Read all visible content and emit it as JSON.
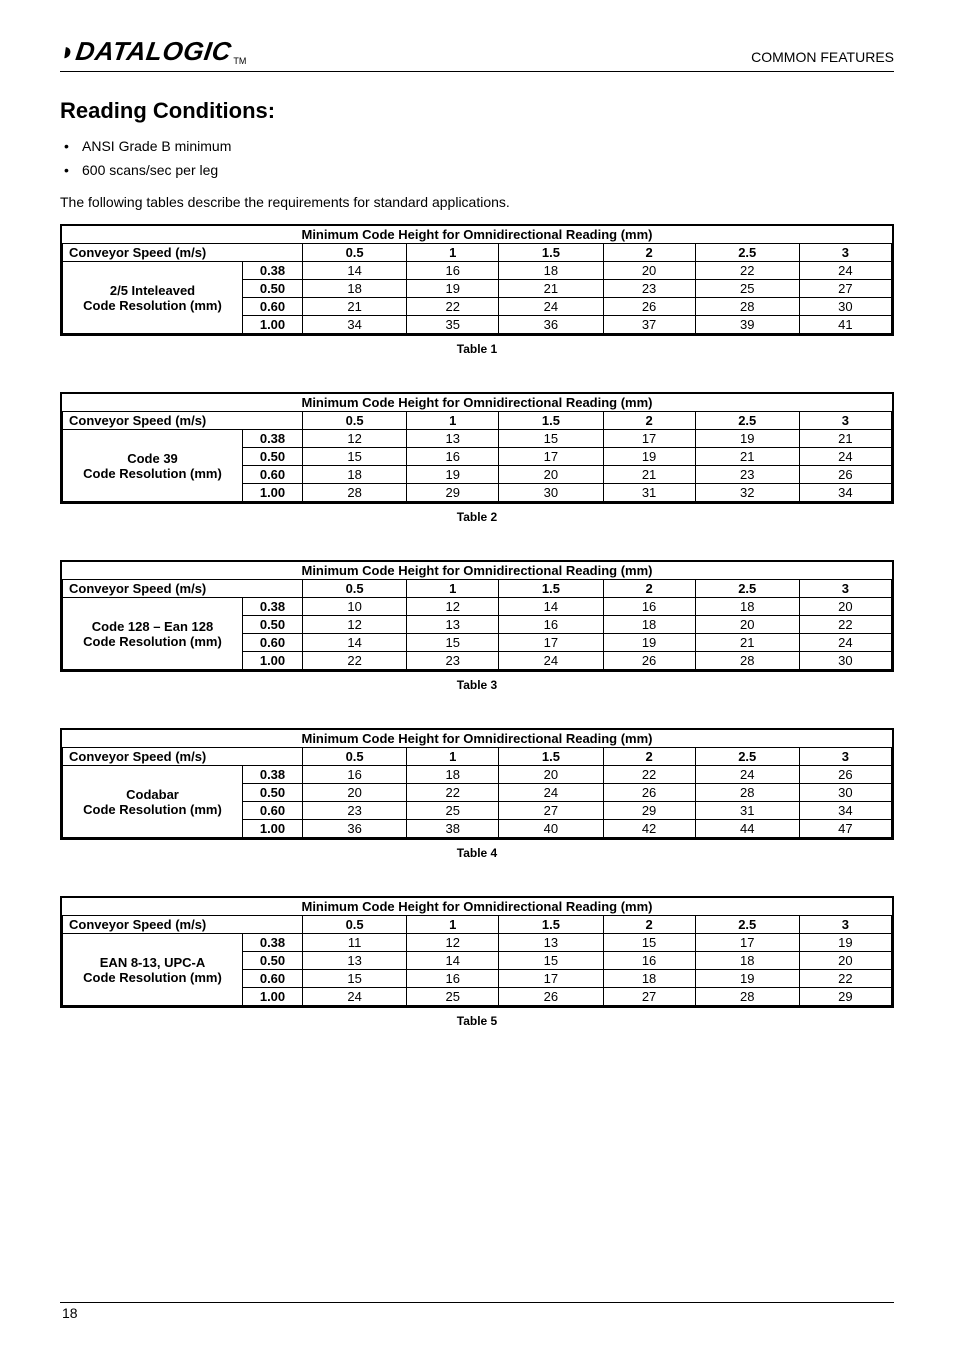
{
  "header": {
    "brand": "DATALOGIC",
    "tm": "TM",
    "section": "COMMON FEATURES"
  },
  "title": "Reading Conditions:",
  "bullets": [
    "ANSI Grade B minimum",
    "600 scans/sec per leg"
  ],
  "intro": "The following tables describe the requirements for standard applications.",
  "common": {
    "tableTitle": "Minimum Code Height for Omnidirectional Reading (mm)",
    "conveyorLabel": "Conveyor Speed (m/s)",
    "speedHeaders": [
      "0.5",
      "1",
      "1.5",
      "2",
      "2.5",
      "3"
    ]
  },
  "tables": [
    {
      "label": [
        "2/5 Inteleaved",
        "Code Resolution (mm)"
      ],
      "caption": "Table 1",
      "rows": [
        {
          "res": "0.38",
          "vals": [
            "14",
            "16",
            "18",
            "20",
            "22",
            "24"
          ]
        },
        {
          "res": "0.50",
          "vals": [
            "18",
            "19",
            "21",
            "23",
            "25",
            "27"
          ]
        },
        {
          "res": "0.60",
          "vals": [
            "21",
            "22",
            "24",
            "26",
            "28",
            "30"
          ]
        },
        {
          "res": "1.00",
          "vals": [
            "34",
            "35",
            "36",
            "37",
            "39",
            "41"
          ]
        }
      ]
    },
    {
      "label": [
        "Code 39",
        "Code Resolution (mm)"
      ],
      "caption": "Table 2",
      "rows": [
        {
          "res": "0.38",
          "vals": [
            "12",
            "13",
            "15",
            "17",
            "19",
            "21"
          ]
        },
        {
          "res": "0.50",
          "vals": [
            "15",
            "16",
            "17",
            "19",
            "21",
            "24"
          ]
        },
        {
          "res": "0.60",
          "vals": [
            "18",
            "19",
            "20",
            "21",
            "23",
            "26"
          ]
        },
        {
          "res": "1.00",
          "vals": [
            "28",
            "29",
            "30",
            "31",
            "32",
            "34"
          ]
        }
      ]
    },
    {
      "label": [
        "Code 128 – Ean 128",
        "Code Resolution (mm)"
      ],
      "caption": "Table 3",
      "rows": [
        {
          "res": "0.38",
          "vals": [
            "10",
            "12",
            "14",
            "16",
            "18",
            "20"
          ]
        },
        {
          "res": "0.50",
          "vals": [
            "12",
            "13",
            "16",
            "18",
            "20",
            "22"
          ]
        },
        {
          "res": "0.60",
          "vals": [
            "14",
            "15",
            "17",
            "19",
            "21",
            "24"
          ]
        },
        {
          "res": "1.00",
          "vals": [
            "22",
            "23",
            "24",
            "26",
            "28",
            "30"
          ]
        }
      ]
    },
    {
      "label": [
        "Codabar",
        "Code Resolution (mm)"
      ],
      "caption": "Table 4",
      "rows": [
        {
          "res": "0.38",
          "vals": [
            "16",
            "18",
            "20",
            "22",
            "24",
            "26"
          ]
        },
        {
          "res": "0.50",
          "vals": [
            "20",
            "22",
            "24",
            "26",
            "28",
            "30"
          ]
        },
        {
          "res": "0.60",
          "vals": [
            "23",
            "25",
            "27",
            "29",
            "31",
            "34"
          ]
        },
        {
          "res": "1.00",
          "vals": [
            "36",
            "38",
            "40",
            "42",
            "44",
            "47"
          ]
        }
      ]
    },
    {
      "label": [
        "EAN 8-13, UPC-A",
        "Code Resolution (mm)"
      ],
      "caption": "Table 5",
      "rows": [
        {
          "res": "0.38",
          "vals": [
            "11",
            "12",
            "13",
            "15",
            "17",
            "19"
          ]
        },
        {
          "res": "0.50",
          "vals": [
            "13",
            "14",
            "15",
            "16",
            "18",
            "20"
          ]
        },
        {
          "res": "0.60",
          "vals": [
            "15",
            "16",
            "17",
            "18",
            "19",
            "22"
          ]
        },
        {
          "res": "1.00",
          "vals": [
            "24",
            "25",
            "26",
            "27",
            "28",
            "29"
          ]
        }
      ]
    }
  ],
  "pageNumber": "18"
}
